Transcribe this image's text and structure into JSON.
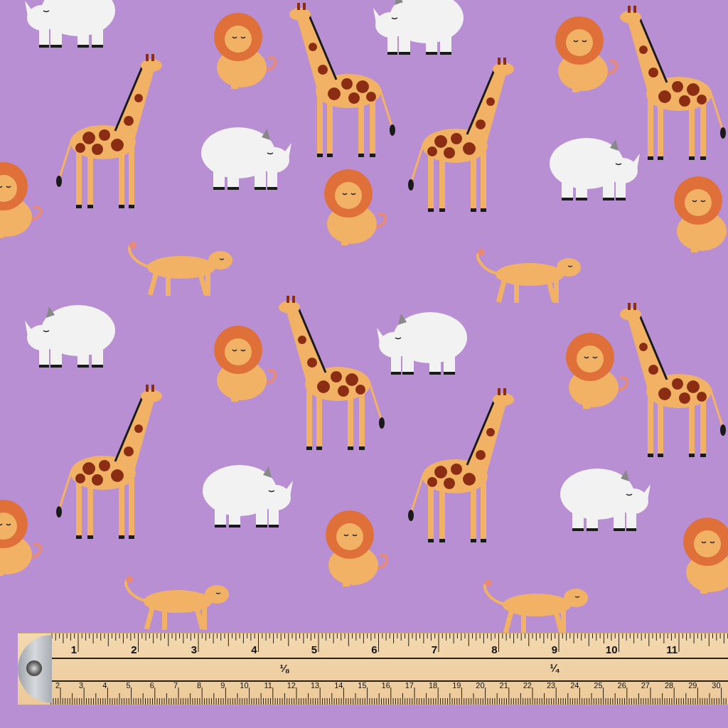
{
  "fabric": {
    "motifs": [
      {
        "kind": "giraffe"
      },
      {
        "kind": "lion"
      },
      {
        "kind": "rhino"
      },
      {
        "kind": "lioness"
      }
    ]
  },
  "ruler": {
    "inch_labels": [
      "1",
      "2",
      "3",
      "4",
      "5",
      "6",
      "7",
      "8",
      "9",
      "10",
      "11"
    ],
    "fraction_labels": [
      "⅛",
      "¼"
    ],
    "cm_labels": [
      "2",
      "3",
      "4",
      "5",
      "6",
      "7",
      "8",
      "9",
      "10",
      "11",
      "12",
      "13",
      "14",
      "15",
      "16",
      "17",
      "18",
      "19",
      "20",
      "21",
      "22",
      "23",
      "24",
      "25",
      "26",
      "27",
      "28",
      "29",
      "30"
    ]
  }
}
